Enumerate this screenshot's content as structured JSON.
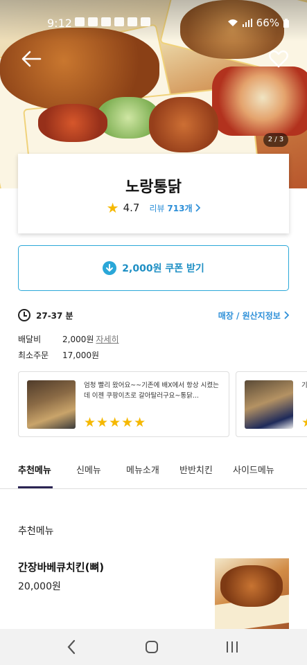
{
  "status_bar": {
    "time": "9:12",
    "battery": "66%"
  },
  "hero": {
    "pager": "2 / 3"
  },
  "store": {
    "name": "노랑통닭",
    "rating": "4.7",
    "review_prefix": "리뷰",
    "review_count": "713개"
  },
  "coupon": {
    "label": "2,000원 쿠폰 받기"
  },
  "delivery": {
    "time_range": "27-37 분",
    "origin_link": "매장 / 원산지정보",
    "fee_label": "배달비",
    "fee_value": "2,000원",
    "fee_more": "자세히",
    "min_order_label": "최소주문",
    "min_order_value": "17,000원"
  },
  "reviews": [
    {
      "text": "엄청 빨리 왔어요~~기존에 배X에서 항상 시켰는데 이젠 쿠팡이츠로 갈아탈러구요~통닭...",
      "stars": "★★★★★"
    },
    {
      "text": "기",
      "stars": "★"
    }
  ],
  "tabs": [
    {
      "label": "추천메뉴"
    },
    {
      "label": "신메뉴"
    },
    {
      "label": "메뉴소개"
    },
    {
      "label": "반반치킨"
    },
    {
      "label": "사이드메뉴"
    }
  ],
  "menu_section": {
    "title": "추천메뉴",
    "items": [
      {
        "name": "간장바베큐치킨(뼈)",
        "price": "20,000원"
      }
    ]
  },
  "icons": {
    "back": "arrow-left-icon",
    "favorite": "heart-outline-icon",
    "rating": "star-icon",
    "coupon": "download-circle-icon",
    "delivery_time": "clock-icon",
    "link": "chevron-right-icon",
    "nav_back": "chevron-left-icon",
    "nav_home": "home-icon",
    "nav_recent": "recent-apps-icon"
  },
  "colors": {
    "accent": "#2aa7d8",
    "link": "#2d8fd8",
    "star": "#f5b800",
    "tab_indicator": "#2b2453"
  }
}
